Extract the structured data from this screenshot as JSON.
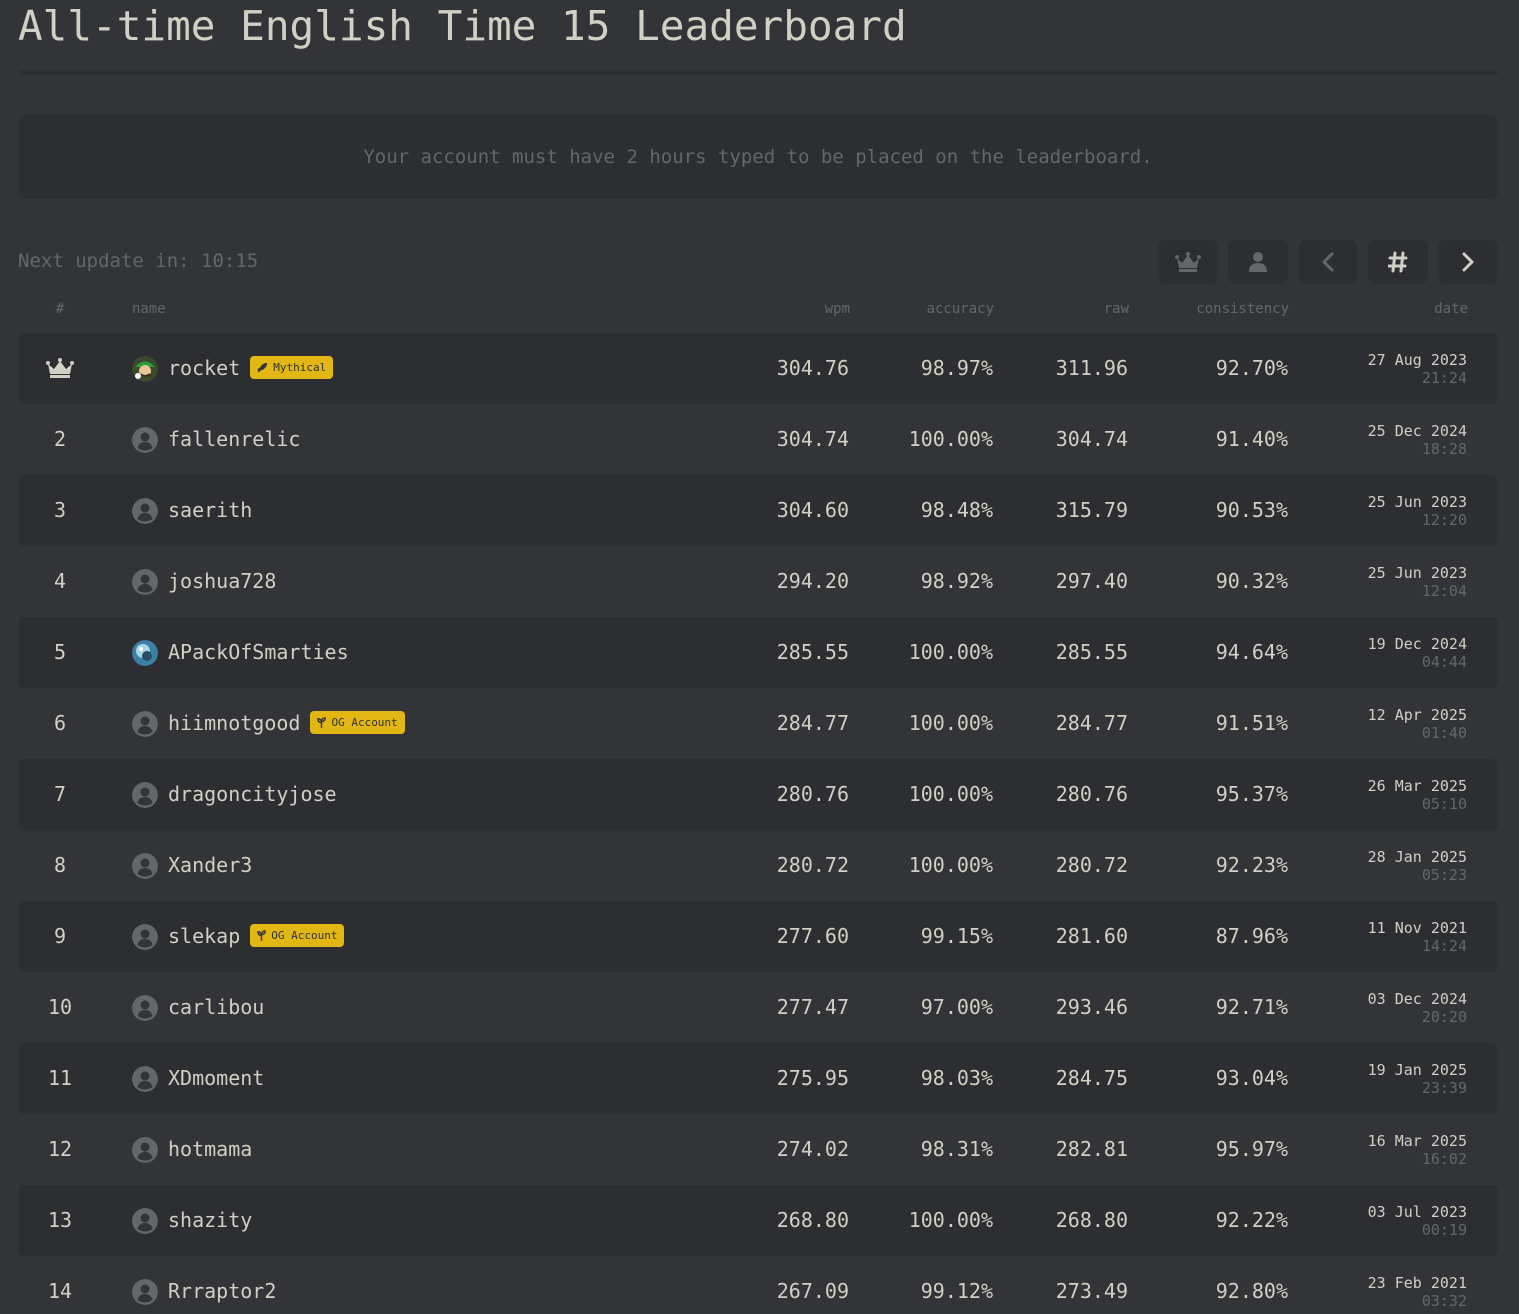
{
  "page": {
    "title": "All-time English Time 15 Leaderboard",
    "notice": "Your account must have 2 hours typed to be placed on the leaderboard.",
    "next_update": "Next update in: 10:15"
  },
  "toolbar": {
    "buttons": [
      {
        "icon": "crown-icon"
      },
      {
        "icon": "user-icon"
      },
      {
        "icon": "chevron-left-icon"
      },
      {
        "icon": "hashtag-icon"
      },
      {
        "icon": "chevron-right-icon"
      }
    ]
  },
  "columns": {
    "rank": "#",
    "name": "name",
    "wpm": "wpm",
    "accuracy": "accuracy",
    "raw": "raw",
    "consistency": "consistency",
    "date": "date"
  },
  "colors": {
    "background": "#323437",
    "row_alt": "#2c2e31",
    "text": "#d1d0c5",
    "sub": "#646669",
    "badge": "#e2b714"
  },
  "rows": [
    {
      "rank": "",
      "rank_icon": "crown-icon",
      "name": "rocket",
      "avatar": "custom-green",
      "badge": {
        "icon": "rocket-icon",
        "label": "Mythical"
      },
      "wpm": "304.76",
      "accuracy": "98.97%",
      "raw": "311.96",
      "consistency": "92.70%",
      "date": "27 Aug 2023",
      "time": "21:24"
    },
    {
      "rank": "2",
      "name": "fallenrelic",
      "avatar": "default",
      "wpm": "304.74",
      "accuracy": "100.00%",
      "raw": "304.74",
      "consistency": "91.40%",
      "date": "25 Dec 2024",
      "time": "18:28"
    },
    {
      "rank": "3",
      "name": "saerith",
      "avatar": "default",
      "wpm": "304.60",
      "accuracy": "98.48%",
      "raw": "315.79",
      "consistency": "90.53%",
      "date": "25 Jun 2023",
      "time": "12:20"
    },
    {
      "rank": "4",
      "name": "joshua728",
      "avatar": "default",
      "wpm": "294.20",
      "accuracy": "98.92%",
      "raw": "297.40",
      "consistency": "90.32%",
      "date": "25 Jun 2023",
      "time": "12:04"
    },
    {
      "rank": "5",
      "name": "APackOfSmarties",
      "avatar": "custom-blue",
      "wpm": "285.55",
      "accuracy": "100.00%",
      "raw": "285.55",
      "consistency": "94.64%",
      "date": "19 Dec 2024",
      "time": "04:44"
    },
    {
      "rank": "6",
      "name": "hiimnotgood",
      "avatar": "default",
      "badge": {
        "icon": "seedling-icon",
        "label": "OG Account"
      },
      "wpm": "284.77",
      "accuracy": "100.00%",
      "raw": "284.77",
      "consistency": "91.51%",
      "date": "12 Apr 2025",
      "time": "01:40"
    },
    {
      "rank": "7",
      "name": "dragoncityjose",
      "avatar": "default",
      "wpm": "280.76",
      "accuracy": "100.00%",
      "raw": "280.76",
      "consistency": "95.37%",
      "date": "26 Mar 2025",
      "time": "05:10"
    },
    {
      "rank": "8",
      "name": "Xander3",
      "avatar": "default",
      "wpm": "280.72",
      "accuracy": "100.00%",
      "raw": "280.72",
      "consistency": "92.23%",
      "date": "28 Jan 2025",
      "time": "05:23"
    },
    {
      "rank": "9",
      "name": "slekap",
      "avatar": "default",
      "badge": {
        "icon": "seedling-icon",
        "label": "OG Account"
      },
      "wpm": "277.60",
      "accuracy": "99.15%",
      "raw": "281.60",
      "consistency": "87.96%",
      "date": "11 Nov 2021",
      "time": "14:24"
    },
    {
      "rank": "10",
      "name": "carlibou",
      "avatar": "default",
      "wpm": "277.47",
      "accuracy": "97.00%",
      "raw": "293.46",
      "consistency": "92.71%",
      "date": "03 Dec 2024",
      "time": "20:20"
    },
    {
      "rank": "11",
      "name": "XDmoment",
      "avatar": "default",
      "wpm": "275.95",
      "accuracy": "98.03%",
      "raw": "284.75",
      "consistency": "93.04%",
      "date": "19 Jan 2025",
      "time": "23:39"
    },
    {
      "rank": "12",
      "name": "hotmama",
      "avatar": "default",
      "wpm": "274.02",
      "accuracy": "98.31%",
      "raw": "282.81",
      "consistency": "95.97%",
      "date": "16 Mar 2025",
      "time": "16:02"
    },
    {
      "rank": "13",
      "name": "shazity",
      "avatar": "default",
      "wpm": "268.80",
      "accuracy": "100.00%",
      "raw": "268.80",
      "consistency": "92.22%",
      "date": "03 Jul 2023",
      "time": "00:19"
    },
    {
      "rank": "14",
      "name": "Rrraptor2",
      "avatar": "default",
      "wpm": "267.09",
      "accuracy": "99.12%",
      "raw": "273.49",
      "consistency": "92.80%",
      "date": "23 Feb 2021",
      "time": "03:32"
    }
  ]
}
